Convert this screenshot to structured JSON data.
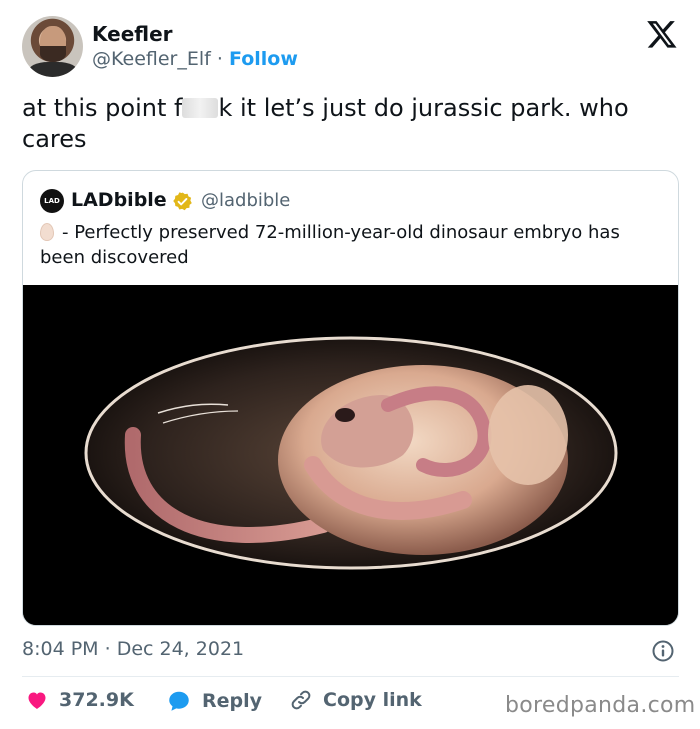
{
  "author": {
    "name": "Keefler",
    "handle": "@Keefler_Elf",
    "separator": "·",
    "follow_label": "Follow"
  },
  "tweet": {
    "text_before": "at this point f",
    "text_after": "k it let’s just do jurassic park. who cares"
  },
  "quoted": {
    "logo_text": "LAD BIBLE",
    "name": "LADbible",
    "handle": "@ladbible",
    "text": "- Perfectly preserved 72-million-year-old dinosaur embryo has been discovered",
    "image_icon": "dinosaur-embryo-in-egg-image"
  },
  "meta": {
    "time": "8:04 PM",
    "separator": "·",
    "date": "Dec 24, 2021"
  },
  "actions": {
    "likes": "372.9K",
    "reply_label": "Reply",
    "copy_label": "Copy link"
  },
  "watermark": "boredpanda.com",
  "colors": {
    "accent": "#1d9bf0",
    "heart": "#f91880",
    "verified": "#e2b719"
  }
}
